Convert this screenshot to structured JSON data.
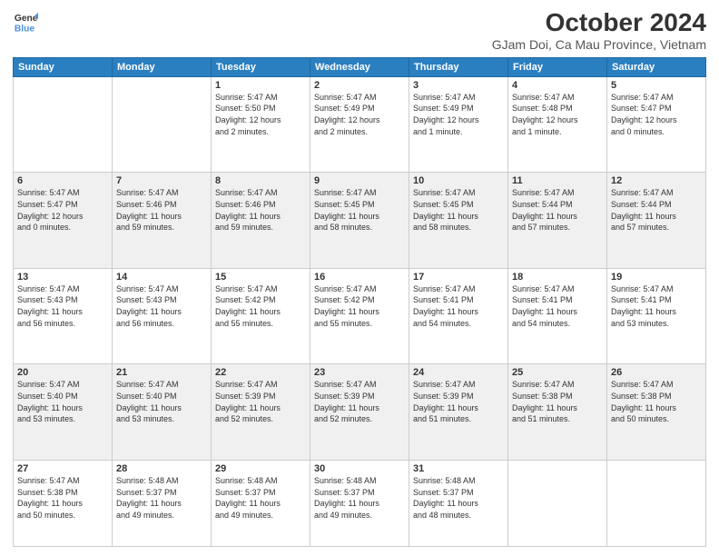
{
  "header": {
    "logo_line1": "General",
    "logo_line2": "Blue",
    "title": "October 2024",
    "subtitle": "GJam Doi, Ca Mau Province, Vietnam"
  },
  "weekdays": [
    "Sunday",
    "Monday",
    "Tuesday",
    "Wednesday",
    "Thursday",
    "Friday",
    "Saturday"
  ],
  "weeks": [
    [
      {
        "day": "",
        "text": ""
      },
      {
        "day": "",
        "text": ""
      },
      {
        "day": "1",
        "text": "Sunrise: 5:47 AM\nSunset: 5:50 PM\nDaylight: 12 hours\nand 2 minutes."
      },
      {
        "day": "2",
        "text": "Sunrise: 5:47 AM\nSunset: 5:49 PM\nDaylight: 12 hours\nand 2 minutes."
      },
      {
        "day": "3",
        "text": "Sunrise: 5:47 AM\nSunset: 5:49 PM\nDaylight: 12 hours\nand 1 minute."
      },
      {
        "day": "4",
        "text": "Sunrise: 5:47 AM\nSunset: 5:48 PM\nDaylight: 12 hours\nand 1 minute."
      },
      {
        "day": "5",
        "text": "Sunrise: 5:47 AM\nSunset: 5:47 PM\nDaylight: 12 hours\nand 0 minutes."
      }
    ],
    [
      {
        "day": "6",
        "text": "Sunrise: 5:47 AM\nSunset: 5:47 PM\nDaylight: 12 hours\nand 0 minutes."
      },
      {
        "day": "7",
        "text": "Sunrise: 5:47 AM\nSunset: 5:46 PM\nDaylight: 11 hours\nand 59 minutes."
      },
      {
        "day": "8",
        "text": "Sunrise: 5:47 AM\nSunset: 5:46 PM\nDaylight: 11 hours\nand 59 minutes."
      },
      {
        "day": "9",
        "text": "Sunrise: 5:47 AM\nSunset: 5:45 PM\nDaylight: 11 hours\nand 58 minutes."
      },
      {
        "day": "10",
        "text": "Sunrise: 5:47 AM\nSunset: 5:45 PM\nDaylight: 11 hours\nand 58 minutes."
      },
      {
        "day": "11",
        "text": "Sunrise: 5:47 AM\nSunset: 5:44 PM\nDaylight: 11 hours\nand 57 minutes."
      },
      {
        "day": "12",
        "text": "Sunrise: 5:47 AM\nSunset: 5:44 PM\nDaylight: 11 hours\nand 57 minutes."
      }
    ],
    [
      {
        "day": "13",
        "text": "Sunrise: 5:47 AM\nSunset: 5:43 PM\nDaylight: 11 hours\nand 56 minutes."
      },
      {
        "day": "14",
        "text": "Sunrise: 5:47 AM\nSunset: 5:43 PM\nDaylight: 11 hours\nand 56 minutes."
      },
      {
        "day": "15",
        "text": "Sunrise: 5:47 AM\nSunset: 5:42 PM\nDaylight: 11 hours\nand 55 minutes."
      },
      {
        "day": "16",
        "text": "Sunrise: 5:47 AM\nSunset: 5:42 PM\nDaylight: 11 hours\nand 55 minutes."
      },
      {
        "day": "17",
        "text": "Sunrise: 5:47 AM\nSunset: 5:41 PM\nDaylight: 11 hours\nand 54 minutes."
      },
      {
        "day": "18",
        "text": "Sunrise: 5:47 AM\nSunset: 5:41 PM\nDaylight: 11 hours\nand 54 minutes."
      },
      {
        "day": "19",
        "text": "Sunrise: 5:47 AM\nSunset: 5:41 PM\nDaylight: 11 hours\nand 53 minutes."
      }
    ],
    [
      {
        "day": "20",
        "text": "Sunrise: 5:47 AM\nSunset: 5:40 PM\nDaylight: 11 hours\nand 53 minutes."
      },
      {
        "day": "21",
        "text": "Sunrise: 5:47 AM\nSunset: 5:40 PM\nDaylight: 11 hours\nand 53 minutes."
      },
      {
        "day": "22",
        "text": "Sunrise: 5:47 AM\nSunset: 5:39 PM\nDaylight: 11 hours\nand 52 minutes."
      },
      {
        "day": "23",
        "text": "Sunrise: 5:47 AM\nSunset: 5:39 PM\nDaylight: 11 hours\nand 52 minutes."
      },
      {
        "day": "24",
        "text": "Sunrise: 5:47 AM\nSunset: 5:39 PM\nDaylight: 11 hours\nand 51 minutes."
      },
      {
        "day": "25",
        "text": "Sunrise: 5:47 AM\nSunset: 5:38 PM\nDaylight: 11 hours\nand 51 minutes."
      },
      {
        "day": "26",
        "text": "Sunrise: 5:47 AM\nSunset: 5:38 PM\nDaylight: 11 hours\nand 50 minutes."
      }
    ],
    [
      {
        "day": "27",
        "text": "Sunrise: 5:47 AM\nSunset: 5:38 PM\nDaylight: 11 hours\nand 50 minutes."
      },
      {
        "day": "28",
        "text": "Sunrise: 5:48 AM\nSunset: 5:37 PM\nDaylight: 11 hours\nand 49 minutes."
      },
      {
        "day": "29",
        "text": "Sunrise: 5:48 AM\nSunset: 5:37 PM\nDaylight: 11 hours\nand 49 minutes."
      },
      {
        "day": "30",
        "text": "Sunrise: 5:48 AM\nSunset: 5:37 PM\nDaylight: 11 hours\nand 49 minutes."
      },
      {
        "day": "31",
        "text": "Sunrise: 5:48 AM\nSunset: 5:37 PM\nDaylight: 11 hours\nand 48 minutes."
      },
      {
        "day": "",
        "text": ""
      },
      {
        "day": "",
        "text": ""
      }
    ]
  ]
}
